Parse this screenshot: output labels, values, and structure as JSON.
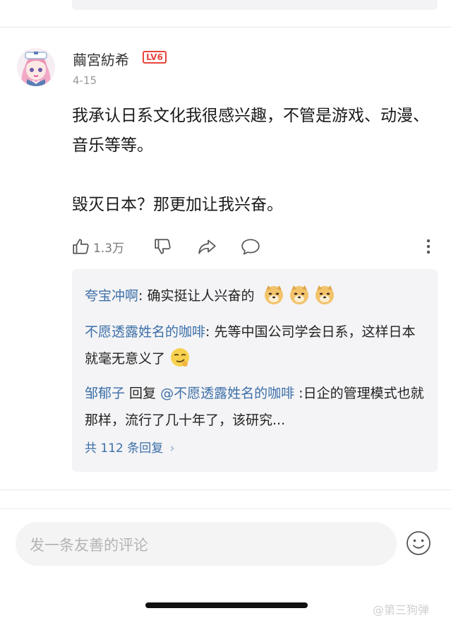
{
  "comment": {
    "username": "繭宮紡希",
    "level": "LV6",
    "date": "4-15",
    "text_line1": "我承认日系文化我很感兴趣，不管是游戏、动漫、音乐等等。",
    "text_line2": "毁灭日本？那更加让我兴奋。",
    "like_count": "1.3万",
    "icons": [
      "thumb-up-icon",
      "thumb-down-icon",
      "share-icon",
      "comment-bubble-icon",
      "more-vertical-icon"
    ]
  },
  "replies": {
    "items": [
      {
        "name": "夸宝冲啊",
        "separator": ": ",
        "text": "确实挺让人兴奋的",
        "emojis": [
          "doge-emoji",
          "doge-emoji",
          "doge-emoji"
        ]
      },
      {
        "name": "不愿透露姓名的咖啡",
        "separator": ": ",
        "text": "先等中国公司学会日系，这样日本就毫无意义了",
        "emojis": [
          "smirk-emoji"
        ]
      },
      {
        "name": "邹郁子",
        "reply_word": " 回复 ",
        "target": "@不愿透露姓名的咖啡",
        "separator": " :",
        "text": "日企的管理模式也就那样，流行了几十年了，该研究..."
      }
    ],
    "more_label": "共 112 条回复",
    "more_chevron": "›"
  },
  "input": {
    "placeholder": "发一条友善的评论",
    "emoji_button_icon": "smile-face-icon"
  },
  "watermark": "@第三狗弹"
}
